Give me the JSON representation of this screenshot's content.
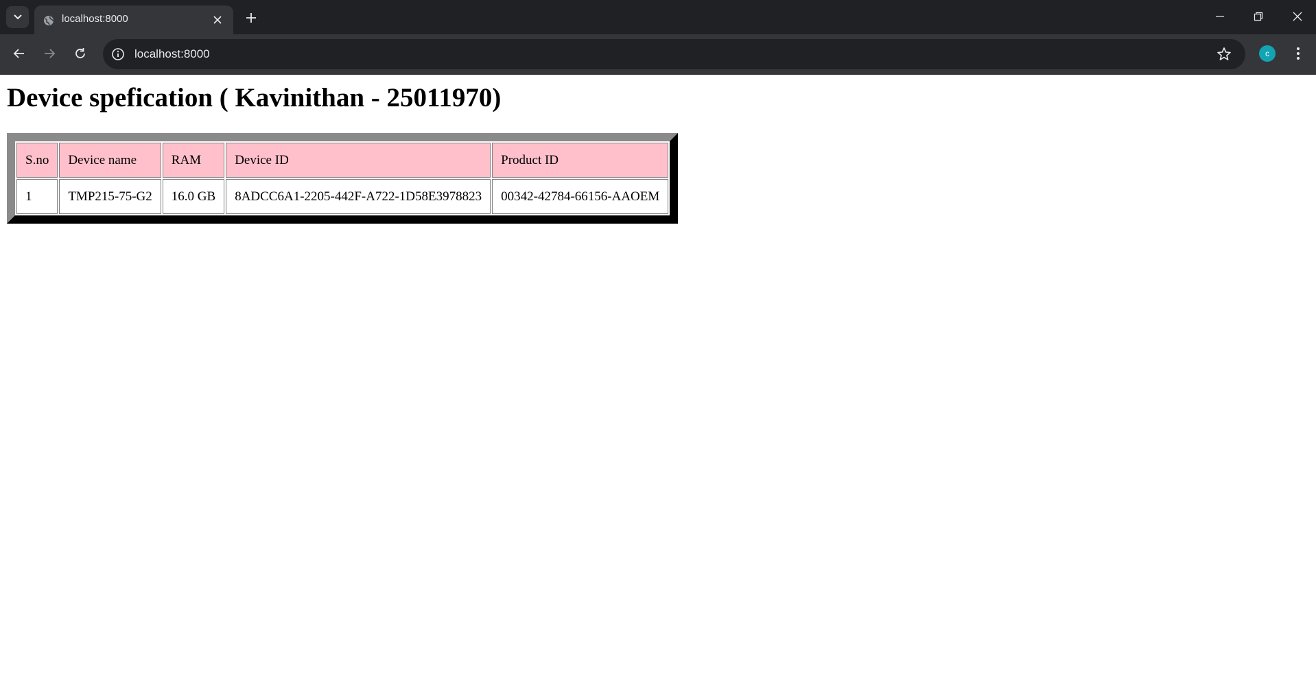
{
  "browser": {
    "tab_title": "localhost:8000",
    "url": "localhost:8000",
    "profile_initial": "c"
  },
  "page": {
    "heading": "Device spefication ( Kavinithan - 25011970)",
    "table": {
      "headers": [
        "S.no",
        "Device name",
        "RAM",
        "Device ID",
        "Product ID"
      ],
      "rows": [
        [
          "1",
          "TMP215-75-G2",
          "16.0 GB",
          "8ADCC6A1-2205-442F-A722-1D58E3978823",
          "00342-42784-66156-AAOEM"
        ]
      ]
    }
  },
  "colors": {
    "header_cell_bg": "#ffc0cb",
    "avatar_bg": "#12a4b3"
  }
}
